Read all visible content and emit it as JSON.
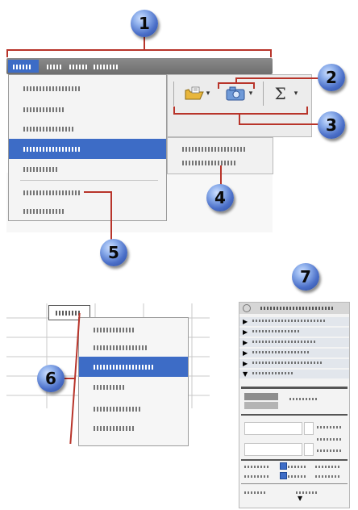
{
  "callouts": [
    {
      "number": "1"
    },
    {
      "number": "2"
    },
    {
      "number": "3"
    },
    {
      "number": "4"
    },
    {
      "number": "5"
    },
    {
      "number": "6"
    },
    {
      "number": "7"
    }
  ],
  "toolbar": {
    "sum_symbol": "Σ",
    "dropdown_arrow": "▾"
  },
  "colors": {
    "callout_line": "#b8342a",
    "selection": "#3d6cc6",
    "menu_bar": "#7a7a7a"
  },
  "icons": {
    "toolbar_1": "folder-icon",
    "toolbar_2": "camera-icon",
    "toolbar_3": "sum-icon"
  }
}
